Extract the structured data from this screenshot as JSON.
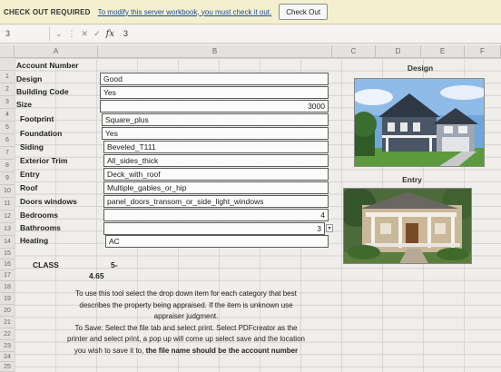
{
  "banner": {
    "status": "CHECK OUT REQUIRED",
    "message": "To modify this server workbook, you must check it out.",
    "button": "Check Out"
  },
  "formula_bar": {
    "name_box": "3",
    "fx_label": "fx",
    "value": "3"
  },
  "columns": [
    "A",
    "B",
    "C",
    "D",
    "E",
    "F"
  ],
  "rows": [
    "",
    "1",
    "2",
    "3",
    "4",
    "5",
    "6",
    "7",
    "8",
    "9",
    "10",
    "11",
    "12",
    "13",
    "14",
    "15",
    "16",
    "17",
    "18",
    "19",
    "20",
    "21",
    "22",
    "23",
    "24",
    "25"
  ],
  "form": {
    "account_number_label": "Account Number",
    "fields": [
      {
        "label": "Design",
        "value": "Good"
      },
      {
        "label": "Building Code",
        "value": "Yes"
      },
      {
        "label": "Size",
        "value": "3000"
      },
      {
        "label": "Footprint",
        "value": "Square_plus"
      },
      {
        "label": "Foundation",
        "value": "Yes"
      },
      {
        "label": "Siding",
        "value": "Beveled_T111"
      },
      {
        "label": "Exterior Trim",
        "value": "All_sides_thick"
      },
      {
        "label": "Entry",
        "value": "Deck_with_roof"
      },
      {
        "label": "Roof",
        "value": "Multiple_gables_or_hip"
      },
      {
        "label": "Doors windows",
        "value": "panel_doors_transom_or_side_light_windows"
      },
      {
        "label": "Bedrooms",
        "value": "4"
      },
      {
        "label": "Bathrooms",
        "value": "3"
      },
      {
        "label": "Heating",
        "value": "AC"
      }
    ],
    "class_label": "CLASS",
    "class_value": "5-",
    "score": "4.65"
  },
  "images": {
    "design_title": "Design",
    "entry_title": "Entry"
  },
  "instructions": {
    "line1": "To use this tool select the drop down item for each category that best",
    "line2": "describes the property being appraised.  If the item is unknown use",
    "line3": "appraiser judgment.",
    "line4": "To Save: Select the file tab and select print.  Select PDFcreator as the",
    "line5": "printer and select print, a pop up will come up select save and the location",
    "line6a": "you wish to save it to, ",
    "line6b": "the file name should be the account number"
  },
  "colors": {
    "banner_bg": "#f4f0cf",
    "link": "#1a4a9a",
    "border": "#5c5c5c"
  }
}
